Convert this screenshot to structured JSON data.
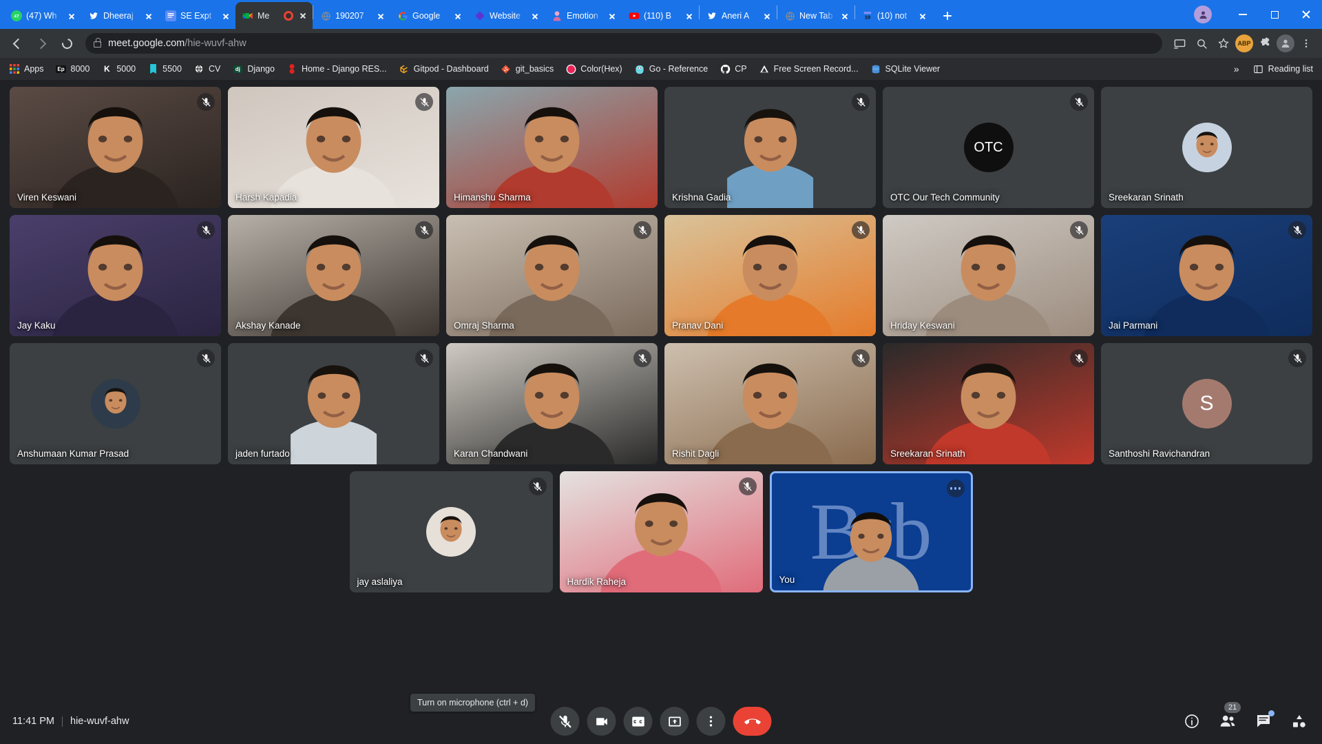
{
  "browser": {
    "tabs": [
      {
        "title": "(47) Wh",
        "favicon": "whatsapp-icon",
        "color": "#25d366",
        "active": false
      },
      {
        "title": "Dheeraj",
        "favicon": "twitter-icon",
        "color": "#1da1f2",
        "active": false
      },
      {
        "title": "SE Expt",
        "favicon": "docs-icon",
        "color": "#4285f4",
        "active": false
      },
      {
        "title": "Me",
        "favicon": "google-meet-icon",
        "color": "#00ac47",
        "active": true,
        "recording": true
      },
      {
        "title": "190207",
        "favicon": "generic-globe-icon",
        "color": "#5f6368",
        "active": false
      },
      {
        "title": "Google",
        "favicon": "google-icon",
        "color": "#ffffff",
        "active": false
      },
      {
        "title": "Website",
        "favicon": "diamond-icon",
        "color": "#5c35d1",
        "active": false
      },
      {
        "title": "Emotion",
        "favicon": "person-icon",
        "color": "#d96ca0",
        "active": false
      },
      {
        "title": "(110) B",
        "favicon": "youtube-icon",
        "color": "#ff0000",
        "active": false
      },
      {
        "title": "Aneri A",
        "favicon": "twitter-icon",
        "color": "#1da1f2",
        "active": false
      },
      {
        "title": "New Tab",
        "favicon": "generic-globe-icon",
        "color": "#5f6368",
        "active": false
      },
      {
        "title": "(10) not",
        "favicon": "notion-10-icon",
        "color": "#8ab4f8",
        "active": false
      }
    ],
    "new_tab_label": "New tab",
    "window_controls": {
      "minimize": "Minimize",
      "maximize": "Maximize",
      "close": "Close"
    },
    "address": {
      "domain": "meet.google.com",
      "path": "/hie-wuvf-ahw",
      "secure": true
    },
    "omnibox_icons": [
      "cast-icon",
      "search-icon",
      "bookmark-star-icon",
      "abp-icon",
      "extensions-icon",
      "profile-icon",
      "menu-icon"
    ],
    "profile_badge": "ABP",
    "bookmarks": [
      {
        "label": "Apps",
        "icon": "apps-grid-icon",
        "color": "#ea4335"
      },
      {
        "label": "8000",
        "icon": "ep-icon",
        "color": "#202124"
      },
      {
        "label": "5000",
        "icon": "k-icon",
        "color": "#101010"
      },
      {
        "label": "5500",
        "icon": "book-icon",
        "color": "#26c6da"
      },
      {
        "label": "CV",
        "icon": "globe-icon",
        "color": "#ffffff"
      },
      {
        "label": "Django",
        "icon": "dj-icon",
        "color": "#0c4b33"
      },
      {
        "label": "Home - Django RES...",
        "icon": "red-dot-icon",
        "color": "#d22"
      },
      {
        "label": "Gitpod - Dashboard",
        "icon": "gitpod-icon",
        "color": "#f5a623"
      },
      {
        "label": "git_basics",
        "icon": "git-icon",
        "color": "#f05133"
      },
      {
        "label": "Color(Hex)",
        "icon": "color-icon",
        "color": "#e8265a"
      },
      {
        "label": "Go - Reference",
        "icon": "gopher-icon",
        "color": "#6ad7e5"
      },
      {
        "label": "CP",
        "icon": "github-icon",
        "color": "#ffffff"
      },
      {
        "label": "Free Screen Record...",
        "icon": "triangle-icon",
        "color": "#ffffff"
      },
      {
        "label": "SQLite Viewer",
        "icon": "sqlite-icon",
        "color": "#4a90d9"
      }
    ],
    "bookmarks_overflow": "»",
    "reading_list_label": "Reading list"
  },
  "meet": {
    "rows": [
      [
        {
          "name": "Viren Keswani",
          "muted": true,
          "kind": "video",
          "tone": "#5b4b45",
          "accent": "#2a2320"
        },
        {
          "name": "Harsh Kapadia",
          "muted": true,
          "kind": "video",
          "tone": "#cfc6be",
          "accent": "#e8e2dc"
        },
        {
          "name": "Himanshu Sharma",
          "muted": false,
          "kind": "video",
          "tone": "#8aa6ad",
          "accent": "#b13b2e"
        },
        {
          "name": "Krishna Gadia",
          "muted": true,
          "kind": "video-narrow",
          "tone": "#3c4043",
          "accent": "#6fa0c4"
        },
        {
          "name": "OTC Our Tech Community",
          "muted": true,
          "kind": "avatar",
          "avatar_text": "OTC",
          "avatar_bg": "#0f0f10"
        },
        {
          "name": "Sreekaran Srinath",
          "muted": false,
          "kind": "avatar-photo",
          "avatar_bg": "#c7d2e0"
        }
      ],
      [
        {
          "name": "Jay Kaku",
          "muted": true,
          "kind": "video",
          "tone": "#4a3f6b",
          "accent": "#2b2440"
        },
        {
          "name": "Akshay Kanade",
          "muted": true,
          "kind": "video",
          "tone": "#b7b0a8",
          "accent": "#3c3530"
        },
        {
          "name": "Omraj Sharma",
          "muted": true,
          "kind": "video",
          "tone": "#c9bfb2",
          "accent": "#7a6a5c"
        },
        {
          "name": "Pranav Dani",
          "muted": true,
          "kind": "video",
          "tone": "#d9c39a",
          "accent": "#e57b2a"
        },
        {
          "name": "Hriday Keswani",
          "muted": true,
          "kind": "video",
          "tone": "#cfcac4",
          "accent": "#9c8c7e"
        },
        {
          "name": "Jai Parmani",
          "muted": true,
          "kind": "video",
          "tone": "#1a3f7a",
          "accent": "#0f2c5c"
        }
      ],
      [
        {
          "name": "Anshumaan Kumar Prasad",
          "muted": true,
          "kind": "avatar-photo",
          "avatar_bg": "#2d3b4a"
        },
        {
          "name": "jaden furtado",
          "muted": true,
          "kind": "video-narrow",
          "tone": "#3c4043",
          "accent": "#cdd4da"
        },
        {
          "name": "Karan Chandwani",
          "muted": true,
          "kind": "video",
          "tone": "#cfcac2",
          "accent": "#2a2a2a"
        },
        {
          "name": "Rishit Dagli",
          "muted": true,
          "kind": "video",
          "tone": "#cdbfae",
          "accent": "#8a6b4e"
        },
        {
          "name": "Sreekaran Srinath",
          "muted": true,
          "kind": "video",
          "tone": "#2a2a2a",
          "accent": "#c0392b"
        },
        {
          "name": "Santhoshi Ravichandran",
          "muted": true,
          "kind": "avatar",
          "avatar_text": "S",
          "avatar_bg": "#a57a6e"
        }
      ],
      [
        {
          "name": "jay aslaliya",
          "muted": true,
          "kind": "avatar-photo",
          "avatar_bg": "#e6e0d8"
        },
        {
          "name": "Hardik Raheja",
          "muted": true,
          "kind": "video",
          "tone": "#e4e2e0",
          "accent": "#e06c7a"
        },
        {
          "name": "You",
          "muted": false,
          "kind": "self",
          "brb_text": "Brb",
          "self_bg": "#0b3d91",
          "more_icon": "more-options-icon"
        }
      ]
    ],
    "tooltip": "Turn on microphone (ctrl + d)",
    "bottom": {
      "time": "11:41 PM",
      "meeting_code": "hie-wuvf-ahw",
      "controls": [
        {
          "name": "microphone-button",
          "icon": "mic-off-icon",
          "label": "Turn on microphone"
        },
        {
          "name": "camera-button",
          "icon": "camera-icon",
          "label": "Turn off camera"
        },
        {
          "name": "captions-button",
          "icon": "captions-icon",
          "label": "Turn on captions"
        },
        {
          "name": "present-button",
          "icon": "present-screen-icon",
          "label": "Present now"
        },
        {
          "name": "more-options-button",
          "icon": "more-vertical-icon",
          "label": "More options"
        },
        {
          "name": "leave-call-button",
          "icon": "end-call-icon",
          "label": "Leave call"
        }
      ],
      "right_controls": [
        {
          "name": "meeting-details-button",
          "icon": "info-icon",
          "label": "Meeting details"
        },
        {
          "name": "participants-button",
          "icon": "people-icon",
          "label": "Show everyone",
          "count": "21"
        },
        {
          "name": "chat-button",
          "icon": "chat-icon",
          "label": "Chat with everyone",
          "has_notification": true
        },
        {
          "name": "activities-button",
          "icon": "activities-icon",
          "label": "Activities"
        }
      ]
    },
    "accent_color": "#8ab4f8",
    "end_call_color": "#ea4335"
  }
}
